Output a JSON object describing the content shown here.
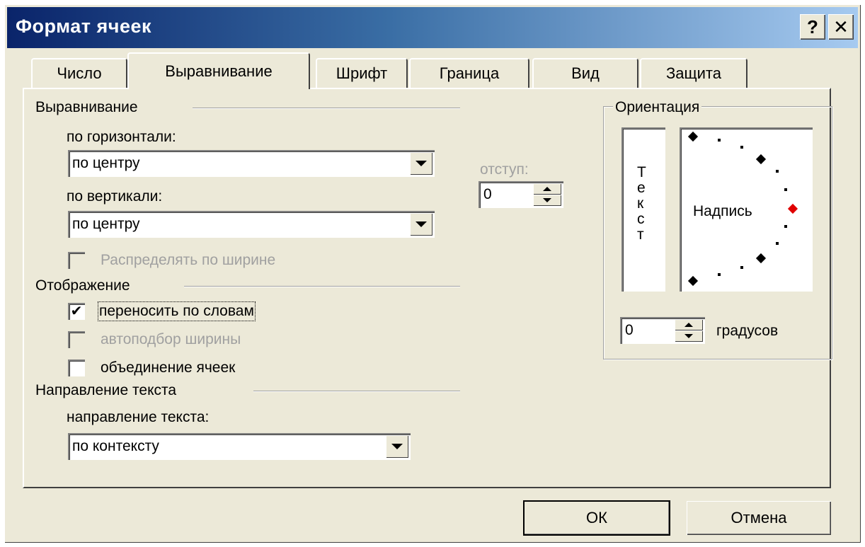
{
  "window": {
    "title": "Формат ячеек"
  },
  "titlebar_buttons": {
    "help": "?",
    "close": "✕"
  },
  "tabs": [
    {
      "label": "Число"
    },
    {
      "label": "Выравнивание",
      "active": true
    },
    {
      "label": "Шрифт"
    },
    {
      "label": "Граница"
    },
    {
      "label": "Вид"
    },
    {
      "label": "Защита"
    }
  ],
  "alignment": {
    "group_label": "Выравнивание",
    "horizontal_label": "по горизонтали:",
    "horizontal_value": "по центру",
    "indent_label": "отступ:",
    "indent_value": "0",
    "vertical_label": "по вертикали:",
    "vertical_value": "по центру",
    "distribute_label": "Распределять по ширине"
  },
  "display": {
    "group_label": "Отображение",
    "wrap_label": "переносить по словам",
    "wrap_checked": true,
    "shrink_label": "автоподбор ширины",
    "shrink_checked": false,
    "merge_label": "объединение ячеек",
    "merge_checked": false
  },
  "text_direction": {
    "group_label": "Направление текста",
    "direction_label": "направление текста:",
    "direction_value": "по контексту"
  },
  "orientation": {
    "group_label": "Ориентация",
    "vertical_text_chars": [
      "Т",
      "е",
      "к",
      "с",
      "т"
    ],
    "dial_label": "Надпись",
    "degrees_value": "0",
    "degrees_label": "градусов"
  },
  "buttons": {
    "ok": "ОК",
    "cancel": "Отмена"
  }
}
